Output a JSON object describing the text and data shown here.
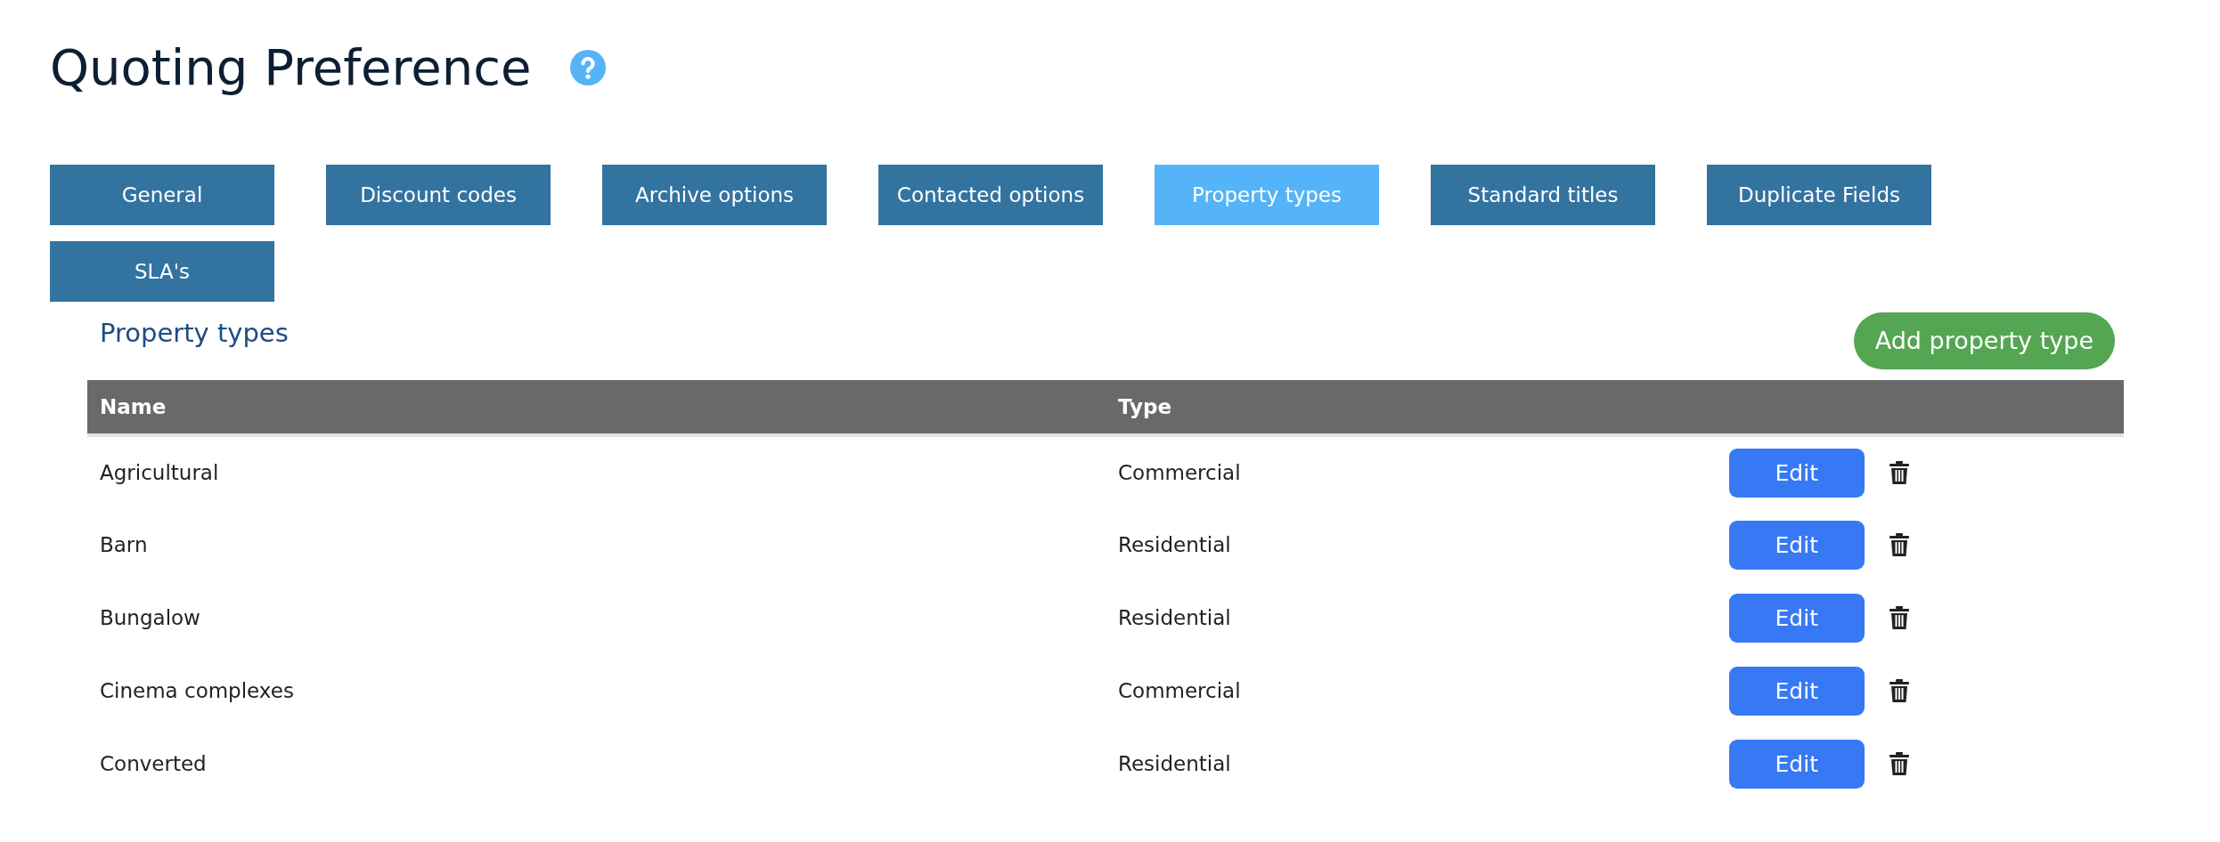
{
  "page": {
    "title": "Quoting Preference"
  },
  "tabs": [
    {
      "label": "General",
      "selected": false
    },
    {
      "label": "Discount codes",
      "selected": false
    },
    {
      "label": "Archive options",
      "selected": false
    },
    {
      "label": "Contacted options",
      "selected": false
    },
    {
      "label": "Property types",
      "selected": true
    },
    {
      "label": "Standard titles",
      "selected": false
    },
    {
      "label": "Duplicate Fields",
      "selected": false
    },
    {
      "label": "SLA's",
      "selected": false
    }
  ],
  "section": {
    "title": "Property types",
    "add_button": "Add property type"
  },
  "table": {
    "columns": [
      "Name",
      "Type"
    ],
    "rows": [
      {
        "name": "Agricultural",
        "type": "Commercial",
        "action": "Edit"
      },
      {
        "name": "Barn",
        "type": "Residential",
        "action": "Edit"
      },
      {
        "name": "Bungalow",
        "type": "Residential",
        "action": "Edit"
      },
      {
        "name": "Cinema complexes",
        "type": "Commercial",
        "action": "Edit"
      },
      {
        "name": "Converted",
        "type": "Residential",
        "action": "Edit"
      }
    ]
  }
}
